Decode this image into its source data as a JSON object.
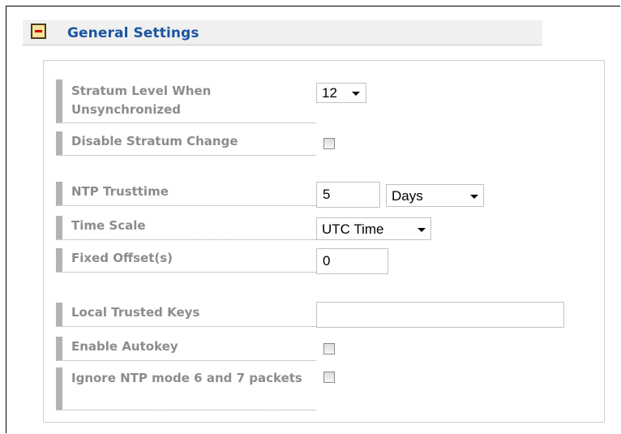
{
  "section": {
    "title": "General Settings",
    "collapse_icon": "minus-icon"
  },
  "fields": {
    "stratum_level": {
      "label": "Stratum Level When Unsynchronized",
      "value": "12"
    },
    "disable_stratum_change": {
      "label": "Disable Stratum Change",
      "checked": false
    },
    "ntp_trusttime": {
      "label": "NTP Trusttime",
      "value": "5",
      "unit": "Days"
    },
    "time_scale": {
      "label": "Time Scale",
      "value": "UTC Time"
    },
    "fixed_offset": {
      "label": "Fixed Offset(s)",
      "value": "0"
    },
    "local_trusted_keys": {
      "label": "Local Trusted Keys",
      "value": ""
    },
    "enable_autokey": {
      "label": "Enable Autokey",
      "checked": false
    },
    "ignore_ntp_mode": {
      "label": "Ignore NTP mode 6 and 7 packets",
      "checked": false
    }
  },
  "colors": {
    "title": "#1b55a3",
    "label": "#8c8c8c",
    "marker": "#b3b3b3"
  }
}
